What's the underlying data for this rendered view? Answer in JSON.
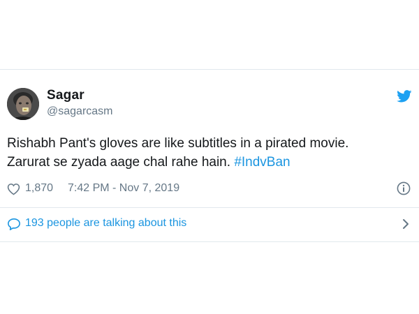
{
  "author": {
    "name": "Sagar",
    "handle": "@sagarcasm",
    "avatar_icon": "user-avatar"
  },
  "tweet": {
    "line1": "Rishabh Pant's gloves are like subtitles in a pirated movie.",
    "line2_text": "Zarurat se zyada aage chal rahe hain. ",
    "hashtag": "#IndvBan"
  },
  "meta": {
    "likes": "1,870",
    "timestamp": "7:42 PM - Nov 7, 2019"
  },
  "conversation": {
    "label": "193 people are talking about this"
  },
  "icons": {
    "brand": "twitter-bird-icon",
    "like": "heart-icon",
    "info": "info-icon",
    "reply": "speech-bubble-icon",
    "more": "chevron-right-icon"
  },
  "colors": {
    "accent": "#1b95e0",
    "twitter_blue": "#1da1f2",
    "text_primary": "#14171a",
    "text_secondary": "#657786",
    "border": "#e1e8ed"
  }
}
